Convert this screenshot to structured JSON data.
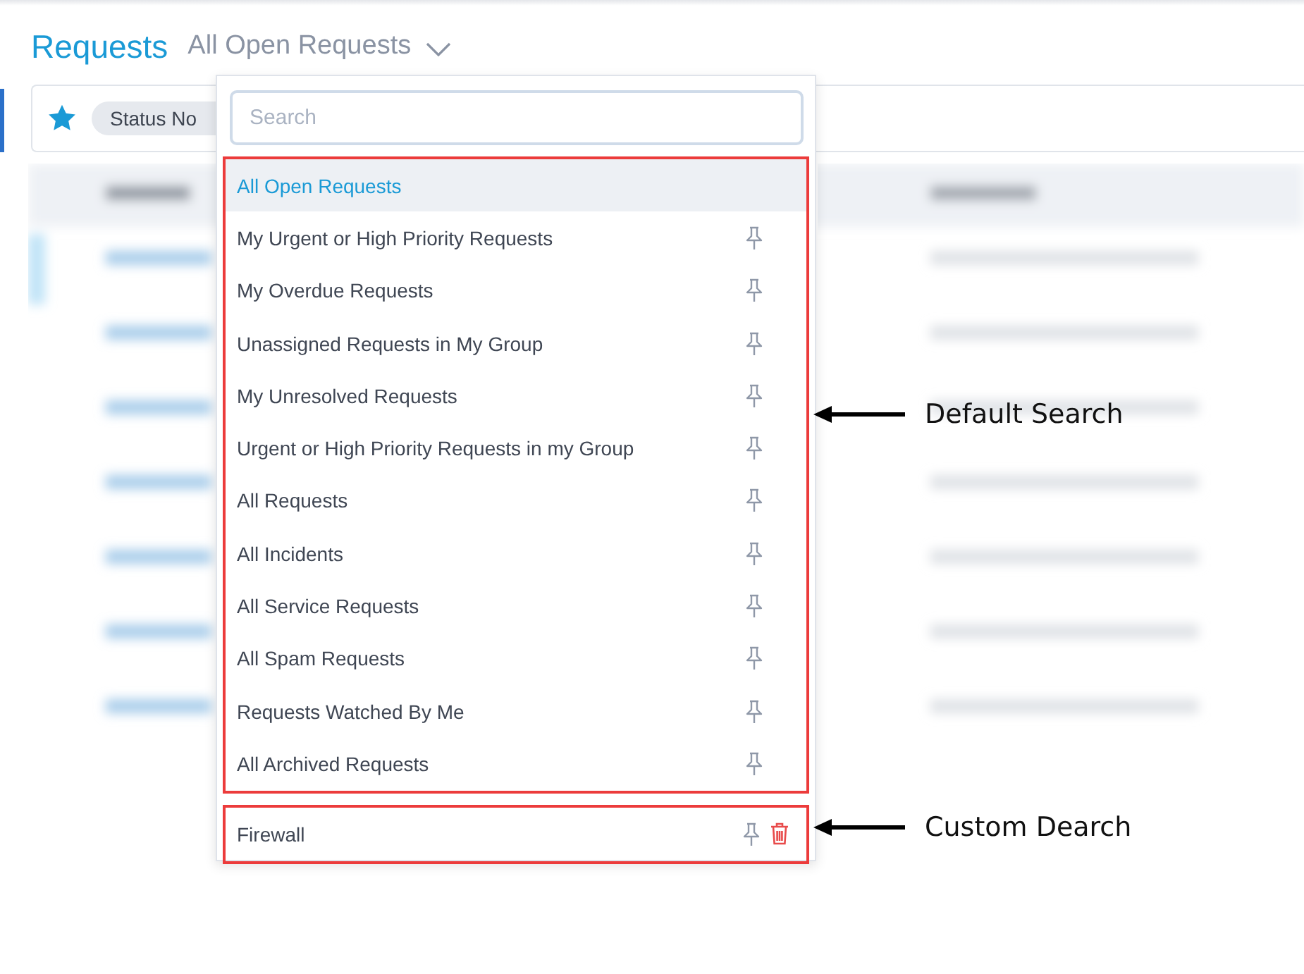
{
  "header": {
    "title": "Requests",
    "view_selector": "All Open Requests"
  },
  "filter_bar": {
    "chip": "Status No"
  },
  "dropdown": {
    "search": {
      "placeholder": "Search"
    },
    "default_searches": [
      {
        "label": "All Open Requests",
        "selected": true
      },
      {
        "label": "My Urgent or High Priority Requests",
        "selected": false
      },
      {
        "label": "My Overdue Requests",
        "selected": false
      },
      {
        "label": "Unassigned Requests in My Group",
        "selected": false
      },
      {
        "label": "My Unresolved Requests",
        "selected": false
      },
      {
        "label": "Urgent or High Priority Requests in my Group",
        "selected": false
      },
      {
        "label": "All Requests",
        "selected": false
      },
      {
        "label": "All Incidents",
        "selected": false
      },
      {
        "label": "All Service Requests",
        "selected": false
      },
      {
        "label": "All Spam Requests",
        "selected": false
      },
      {
        "label": "Requests Watched By Me",
        "selected": false
      },
      {
        "label": "All Archived Requests",
        "selected": false
      }
    ],
    "custom_searches": [
      {
        "label": "Firewall",
        "selected": false
      }
    ]
  },
  "annotations": [
    {
      "kind": "default",
      "text": "Default Search"
    },
    {
      "kind": "custom",
      "text": "Custom Dearch"
    }
  ]
}
